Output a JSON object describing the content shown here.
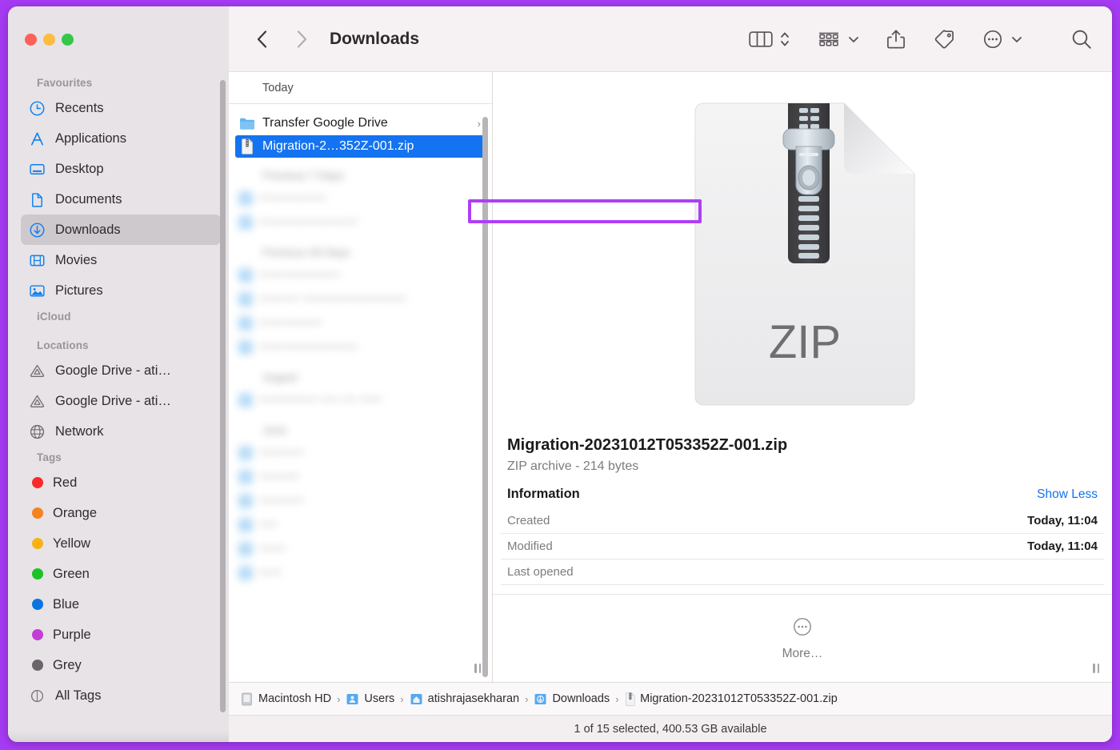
{
  "window": {
    "traffic_lights": [
      "close",
      "minimize",
      "zoom"
    ],
    "accent_selection": "#1473f0",
    "annotation_outline": "#ad3ff5",
    "frame_color": "#a53bf2"
  },
  "toolbar": {
    "back_label": "Back",
    "forward_label": "Forward",
    "title": "Downloads",
    "view_label": "Column View",
    "view_chevron": "Change view options",
    "group_label": "Group Items",
    "share_label": "Share",
    "tag_label": "Edit Tags",
    "action_label": "More Actions",
    "search_label": "Search"
  },
  "sidebar": {
    "groups": [
      {
        "title": "Favourites",
        "items": [
          {
            "label": "Recents",
            "icon": "clock-icon",
            "active": false
          },
          {
            "label": "Applications",
            "icon": "applications-icon",
            "active": false
          },
          {
            "label": "Desktop",
            "icon": "desktop-icon",
            "active": false
          },
          {
            "label": "Documents",
            "icon": "document-icon",
            "active": false
          },
          {
            "label": "Downloads",
            "icon": "downloads-icon",
            "active": true
          },
          {
            "label": "Movies",
            "icon": "movies-icon",
            "active": false
          },
          {
            "label": "Pictures",
            "icon": "pictures-icon",
            "active": false
          }
        ]
      },
      {
        "title": "iCloud",
        "items": []
      },
      {
        "title": "Locations",
        "items": [
          {
            "label": "Google Drive - ati…",
            "icon": "google-drive-icon",
            "active": false
          },
          {
            "label": "Google Drive - ati…",
            "icon": "google-drive-icon",
            "active": false
          },
          {
            "label": "Network",
            "icon": "network-globe-icon",
            "active": false
          }
        ]
      },
      {
        "title": "Tags",
        "items": [
          {
            "label": "Red",
            "icon": "tag-dot-icon",
            "color": "#f72b2b",
            "active": false
          },
          {
            "label": "Orange",
            "icon": "tag-dot-icon",
            "color": "#f6821f",
            "active": false
          },
          {
            "label": "Yellow",
            "icon": "tag-dot-icon",
            "color": "#f8b213",
            "active": false
          },
          {
            "label": "Green",
            "icon": "tag-dot-icon",
            "color": "#1ec226",
            "active": false
          },
          {
            "label": "Blue",
            "icon": "tag-dot-icon",
            "color": "#0b74e0",
            "active": false
          },
          {
            "label": "Purple",
            "icon": "tag-dot-icon",
            "color": "#c23ed6",
            "active": false
          },
          {
            "label": "Grey",
            "icon": "tag-dot-icon",
            "color": "#68666a",
            "active": false
          },
          {
            "label": "All Tags",
            "icon": "all-tags-icon",
            "color": "",
            "active": false
          }
        ]
      }
    ]
  },
  "file_column": {
    "section_header": "Today",
    "rows": [
      {
        "name": "Transfer Google Drive",
        "icon": "folder-icon",
        "has_chevron": true,
        "selected": false
      },
      {
        "name": "Migration-2…352Z-001.zip",
        "icon": "zip-file-icon",
        "has_chevron": false,
        "selected": true
      }
    ],
    "blurred_sections": [
      {
        "title": "Previous 7 Days",
        "rows": [
          "•••••••••••••••",
          "••••••••••••••••••••••"
        ]
      },
      {
        "title": "Previous 30 Days",
        "rows": [
          "••••••••••••••••••",
          "••••••••• •••••••••••••••••••••••",
          "••••••••••••••",
          "••••••••••••••••••••••"
        ]
      },
      {
        "title": "August",
        "rows": [
          "••••••••••••• •••• ••• •••••"
        ]
      },
      {
        "title": "June",
        "rows": [
          "••••••••••",
          "•••••••••",
          "••••••••••",
          "••••",
          "••••••",
          "•••••"
        ]
      }
    ]
  },
  "preview": {
    "icon_label": "ZIP",
    "file_name": "Migration-20231012T053352Z-001.zip",
    "file_meta": "ZIP archive - 214 bytes",
    "information_heading": "Information",
    "toggle_link": "Show Less",
    "rows": [
      {
        "key": "Created",
        "value": "Today, 11:04"
      },
      {
        "key": "Modified",
        "value": "Today, 11:04"
      },
      {
        "key": "Last opened",
        "value": ""
      }
    ],
    "more_label": "More…"
  },
  "path_bar": {
    "crumbs": [
      {
        "label": "Macintosh HD",
        "icon": "hard-drive-icon"
      },
      {
        "label": "Users",
        "icon": "folder-users-icon"
      },
      {
        "label": "atishrajasekharan",
        "icon": "folder-home-icon"
      },
      {
        "label": "Downloads",
        "icon": "folder-downloads-icon"
      },
      {
        "label": "Migration-20231012T053352Z-001.zip",
        "icon": "zip-file-icon"
      }
    ],
    "separator": "›"
  },
  "status_bar": {
    "text": "1 of 15 selected, 400.53 GB available"
  }
}
